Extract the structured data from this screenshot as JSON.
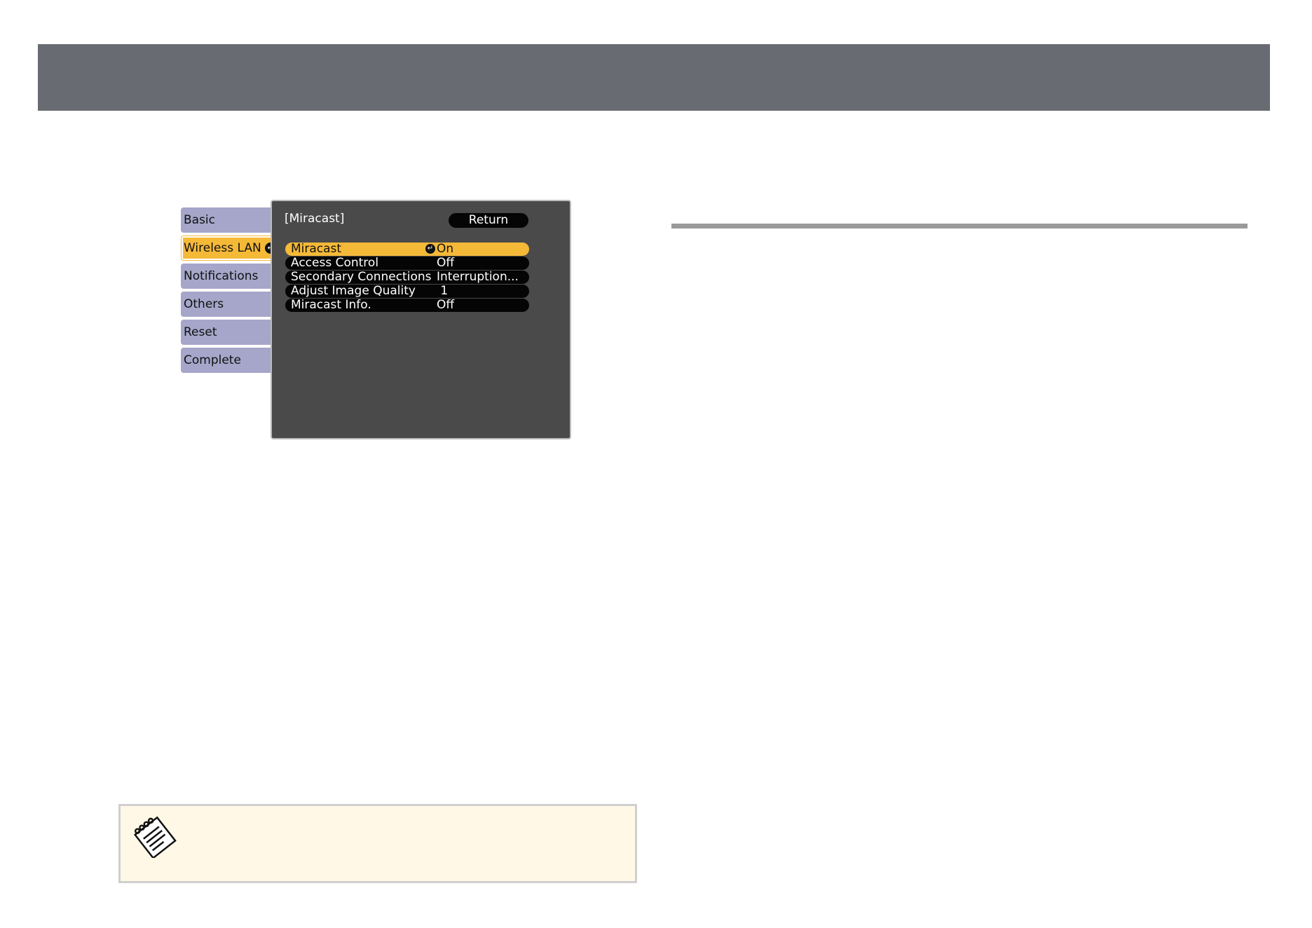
{
  "sidebar": {
    "tabs": [
      {
        "label": "Basic",
        "selected": false
      },
      {
        "label": "Wireless LAN",
        "selected": true
      },
      {
        "label": "Notifications",
        "selected": false
      },
      {
        "label": "Others",
        "selected": false
      },
      {
        "label": "Reset",
        "selected": false
      },
      {
        "label": "Complete",
        "selected": false
      }
    ],
    "enter_symbol": "↵"
  },
  "panel": {
    "title": "[Miracast]",
    "return_label": "Return",
    "rows": [
      {
        "label": "Miracast",
        "value": "On",
        "selected": true
      },
      {
        "label": "Access Control",
        "value": "Off",
        "selected": false
      },
      {
        "label": "Secondary Connections",
        "value": "Interruption...",
        "selected": false
      },
      {
        "label": "Adjust Image Quality",
        "value": " 1",
        "selected": false
      },
      {
        "label": "Miracast Info.",
        "value": "Off",
        "selected": false
      }
    ]
  },
  "colors": {
    "header_bar": "#696b73",
    "tab_normal": "#a5a6c9",
    "tab_selected": "#f5b938",
    "panel_bg": "#4a4a4a",
    "note_bg": "#fff8e6"
  },
  "icons": {
    "enter": "enter-icon",
    "note": "note-pad-icon"
  }
}
